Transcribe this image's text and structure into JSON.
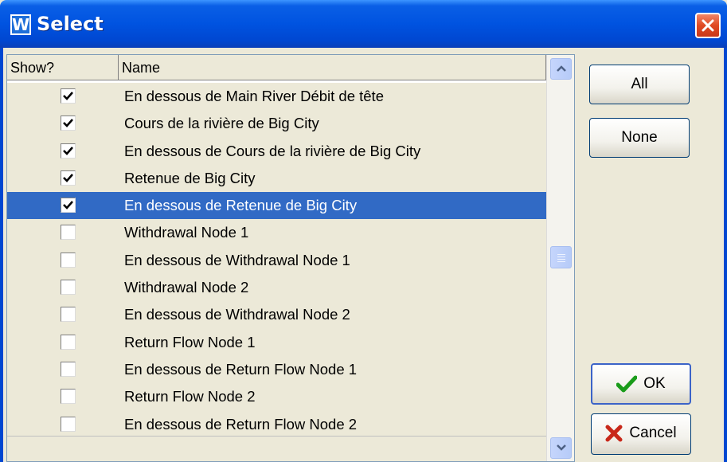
{
  "window": {
    "title": "Select",
    "app_icon_letter": "W"
  },
  "grid": {
    "columns": {
      "show": "Show?",
      "name": "Name"
    },
    "rows": [
      {
        "checked": true,
        "name": "En dessous de Main River Débit de tête",
        "selected": false
      },
      {
        "checked": true,
        "name": "Cours de la rivière de Big City",
        "selected": false
      },
      {
        "checked": true,
        "name": "En dessous de Cours de la rivière de Big City",
        "selected": false
      },
      {
        "checked": true,
        "name": "Retenue de Big City",
        "selected": false
      },
      {
        "checked": true,
        "name": "En dessous de Retenue de Big City",
        "selected": true
      },
      {
        "checked": false,
        "name": "Withdrawal Node 1",
        "selected": false
      },
      {
        "checked": false,
        "name": "En dessous de Withdrawal Node 1",
        "selected": false
      },
      {
        "checked": false,
        "name": "Withdrawal Node 2",
        "selected": false
      },
      {
        "checked": false,
        "name": "En dessous de Withdrawal Node 2",
        "selected": false
      },
      {
        "checked": false,
        "name": "Return Flow Node 1",
        "selected": false
      },
      {
        "checked": false,
        "name": "En dessous de Return Flow Node 1",
        "selected": false
      },
      {
        "checked": false,
        "name": "Return Flow Node 2",
        "selected": false
      },
      {
        "checked": false,
        "name": "En dessous de Return Flow Node 2",
        "selected": false
      }
    ]
  },
  "buttons": {
    "all": "All",
    "none": "None",
    "ok": "OK",
    "cancel": "Cancel"
  },
  "icons": {
    "close": "close-icon",
    "ok": "checkmark-icon",
    "cancel": "x-icon",
    "scroll_up": "chevron-up-icon",
    "scroll_down": "chevron-down-icon"
  },
  "colors": {
    "title_bar": "#0053e0",
    "selection": "#316ac5",
    "close_button": "#e04a23",
    "ok_icon": "#1a9c1a",
    "cancel_icon": "#c8281a"
  }
}
